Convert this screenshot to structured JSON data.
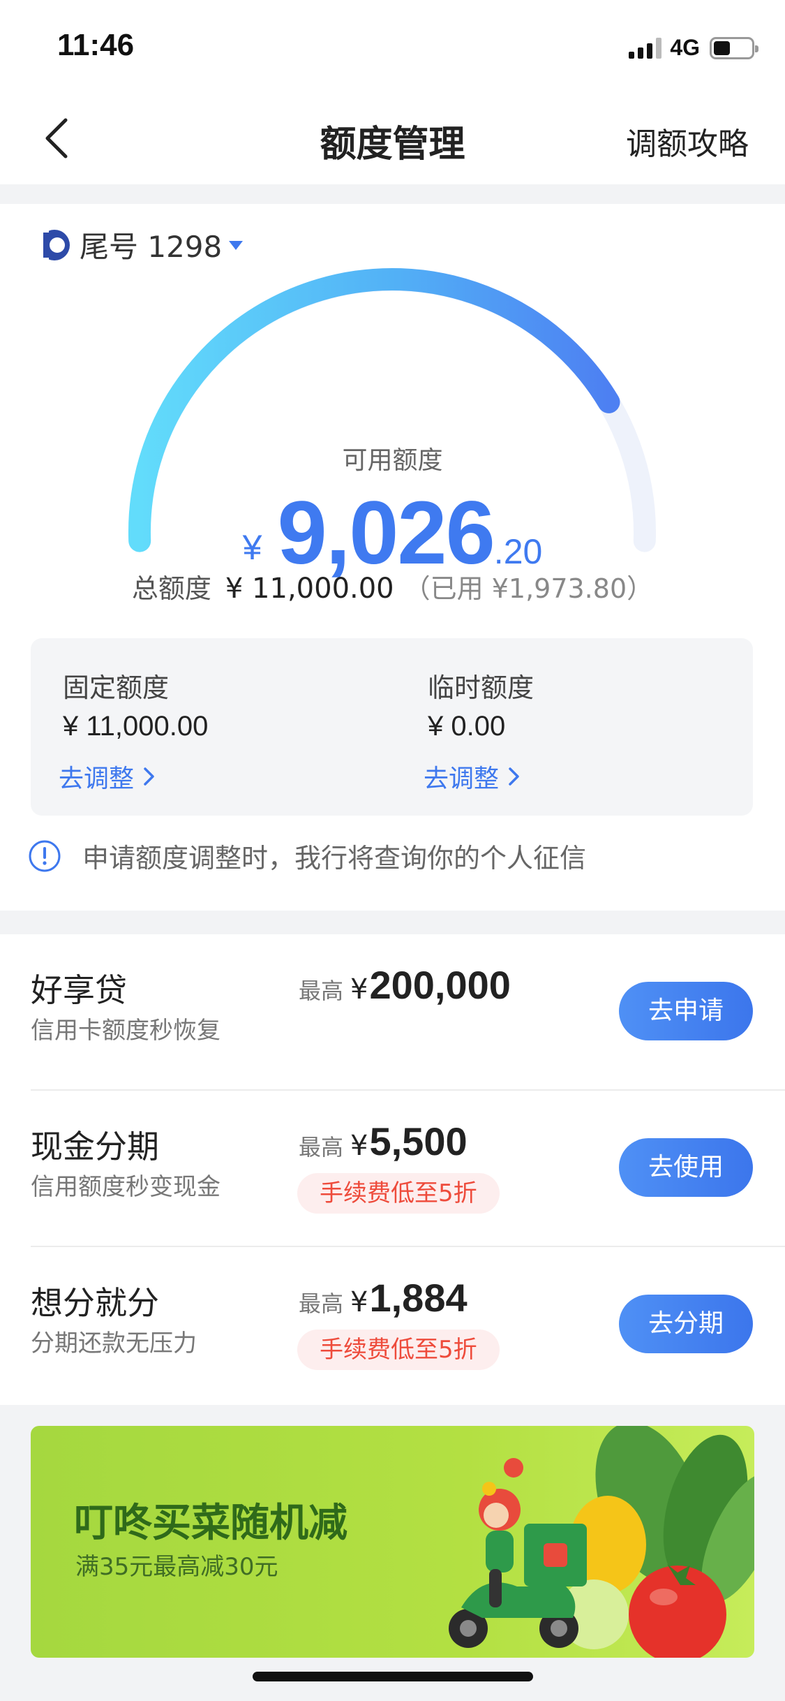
{
  "status_bar": {
    "time": "11:46",
    "network": "4G",
    "battery_level": 0.45
  },
  "nav": {
    "title": "额度管理",
    "right_action": "调额攻略"
  },
  "card": {
    "label": "尾号 1298"
  },
  "gauge": {
    "label": "可用额度",
    "currency": "¥",
    "amount_int": "9,026",
    "amount_dec": ".20",
    "used_fraction": 0.179
  },
  "total": {
    "label": "总额度",
    "value": "¥ 11,000.00",
    "used": "（已用 ¥1,973.80）"
  },
  "fixed_limit": {
    "title": "固定额度",
    "value": "¥ 11,000.00",
    "link": "去调整"
  },
  "temp_limit": {
    "title": "临时额度",
    "value": "¥ 0.00",
    "link": "去调整"
  },
  "notice": "申请额度调整时，我行将查询你的个人征信",
  "products": [
    {
      "name": "好享贷",
      "subtitle": "信用卡额度秒恢复",
      "max_label": "最高",
      "currency": "¥",
      "max_value": "200,000",
      "tag": "",
      "button": "去申请"
    },
    {
      "name": "现金分期",
      "subtitle": "信用额度秒变现金",
      "max_label": "最高",
      "currency": "¥",
      "max_value": "5,500",
      "tag": "手续费低至5折",
      "button": "去使用"
    },
    {
      "name": "想分就分",
      "subtitle": "分期还款无压力",
      "max_label": "最高",
      "currency": "¥",
      "max_value": "1,884",
      "tag": "手续费低至5折",
      "button": "去分期"
    }
  ],
  "banner": {
    "title": "叮咚买菜随机减",
    "subtitle": "满35元最高减30元"
  },
  "colors": {
    "accent": "#3e78ee",
    "amount": "#3f7af0",
    "tag_text": "#ee4b3b",
    "banner_bg": "#b3e042"
  }
}
